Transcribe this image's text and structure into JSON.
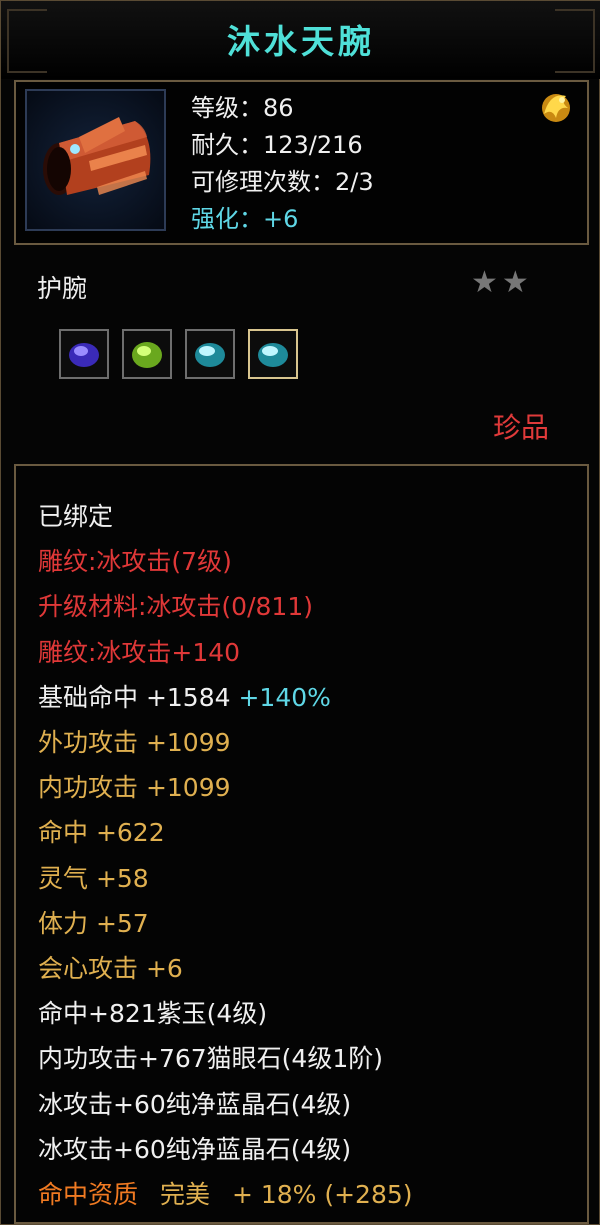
{
  "title": "沐水天腕",
  "header": {
    "level": "等级：86",
    "durability": "耐久：123/216",
    "repairs": "可修理次数：2/3",
    "enhance": "强化：+6"
  },
  "item_type": "护腕",
  "stars": "★★",
  "gems": [
    "purple-gem-icon",
    "green-gem-icon",
    "cyan-gem-icon",
    "cyan-gem-icon"
  ],
  "rarity": "珍品",
  "attributes": {
    "bound": "已绑定",
    "engrave1": "雕纹:冰攻击(7级)",
    "upgrade": "升级材料:冰攻击(0/811)",
    "engrave2": "雕纹:冰攻击+140",
    "base_hit_label": "基础命中  +1584",
    "base_hit_bonus": "+140%",
    "outer_attack": "外功攻击  +1099",
    "inner_attack": "内功攻击  +1099",
    "hit": "命中  +622",
    "spirit": "灵气  +58",
    "stamina": "体力  +57",
    "crit": "会心攻击  +6",
    "gem1": "命中+821紫玉(4级)",
    "gem2": "内功攻击+767猫眼石(4级1阶)",
    "gem3": "冰攻击+60纯净蓝晶石(4级)",
    "gem4": "冰攻击+60纯净蓝晶石(4级)",
    "aptitude_label": "命中资质",
    "aptitude_grade": "完美",
    "aptitude_value": "+ 18% (+285)"
  }
}
